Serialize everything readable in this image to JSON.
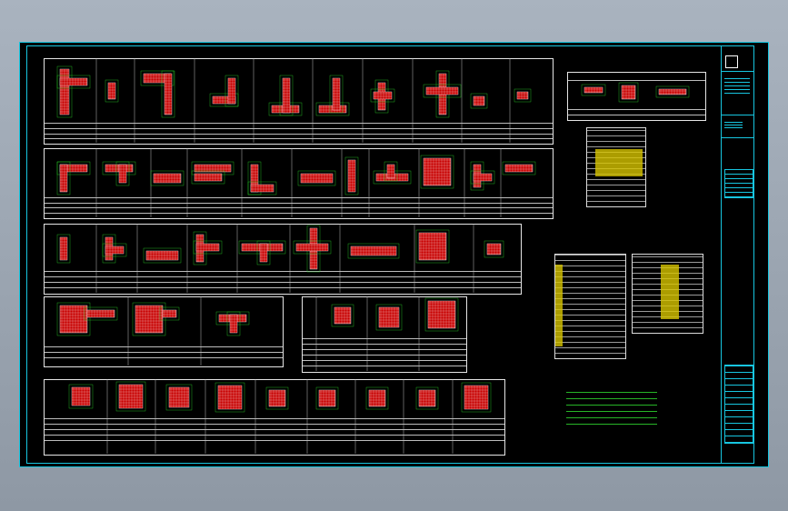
{
  "sheet": {
    "background": "#000000",
    "frame_color": "#17c6e0",
    "section_color": "#c80000",
    "dimension_color": "#27d227",
    "table_highlight": "#d7c400"
  },
  "panels": [
    {
      "name": "shear-wall-edge-members-row-1",
      "cells": 10
    },
    {
      "name": "shear-wall-edge-members-row-2",
      "cells": 10
    },
    {
      "name": "shear-wall-edge-members-row-3",
      "cells": 9
    },
    {
      "name": "column-sections-row-4",
      "cells": 3
    },
    {
      "name": "column-sections-small-table",
      "cells": 3
    },
    {
      "name": "column-sections-row-5",
      "cells": 9
    }
  ],
  "title_block": {
    "labels": []
  },
  "notes": {
    "lines": []
  }
}
